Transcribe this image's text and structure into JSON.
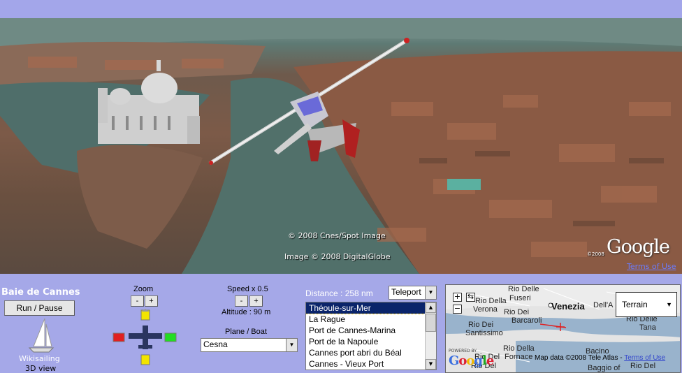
{
  "earth": {
    "credit_cnes": "© 2008 Cnes/Spot Image",
    "credit_digitalglobe": "Image © 2008 DigitalGlobe",
    "credit_year": "©2008",
    "logo": "Google",
    "terms": "Terms of Use"
  },
  "panel": {
    "title": "Baie de Cannes",
    "run_pause": "Run / Pause",
    "wiki_label": "Wikisailing",
    "view_label": "3D view",
    "zoom_label": "Zoom",
    "zoom_minus": "-",
    "zoom_plus": "+",
    "speed_label": "Speed x 0.5",
    "speed_minus": "-",
    "speed_plus": "+",
    "altitude": "Altitude : 90 m",
    "plane_boat_label": "Plane / Boat",
    "vehicle_selected": "Cesna",
    "distance": "Distance : 258 nm",
    "teleport_selected": "Teleport",
    "destinations": [
      "Théoule-sur-Mer",
      "La Rague",
      "Port de Cannes-Marina",
      "Port de la Napoule",
      "Cannes port abri du Béal",
      "Cannes - Vieux Port"
    ],
    "selected_destination_index": 0
  },
  "minimap": {
    "zoom_in": "+",
    "zoom_out": "−",
    "terrain_label": "Terrain",
    "places": {
      "rio_delle_1": "Rio Delle",
      "fuseri": "Fuseri",
      "rio_della_1": "Rio Della",
      "verona": "Verona",
      "venezia": "Venezia",
      "dell_a": "Dell'A",
      "rio_dei_1": "Rio Dei",
      "barcaroli": "Barcaroli",
      "santissimo": "Santissimo",
      "rio_della_2": "Rio Della",
      "fornace": "Fornace",
      "bacino": "Bacino",
      "rio_del_1": "Rio Del",
      "rio_del_2": "Rio Del",
      "rio_del_3": "Rio Del",
      "rio_dei_2": "Rio Dei",
      "tana": "Tana",
      "baggio_of": "Baggio of",
      "rio_delle_2": "Rio Delle"
    },
    "copyright": "Map data ©2008 Tele Atlas - ",
    "terms": "Terms of Use",
    "powered": "POWERED BY",
    "logo": "Google"
  },
  "colors": {
    "panel_bg": "#a5a8e8",
    "title_text": "#ffffff",
    "list_selected_bg": "#0a246a"
  },
  "icons": {
    "sailboat": "sailboat-icon",
    "joystick_up": "yellow-arrow-up-icon",
    "joystick_down": "yellow-arrow-down-icon",
    "joystick_left": "red-arrow-left-icon",
    "joystick_right": "green-arrow-right-icon",
    "plane": "plane-icon",
    "position_marker": "red-plane-marker-icon"
  }
}
